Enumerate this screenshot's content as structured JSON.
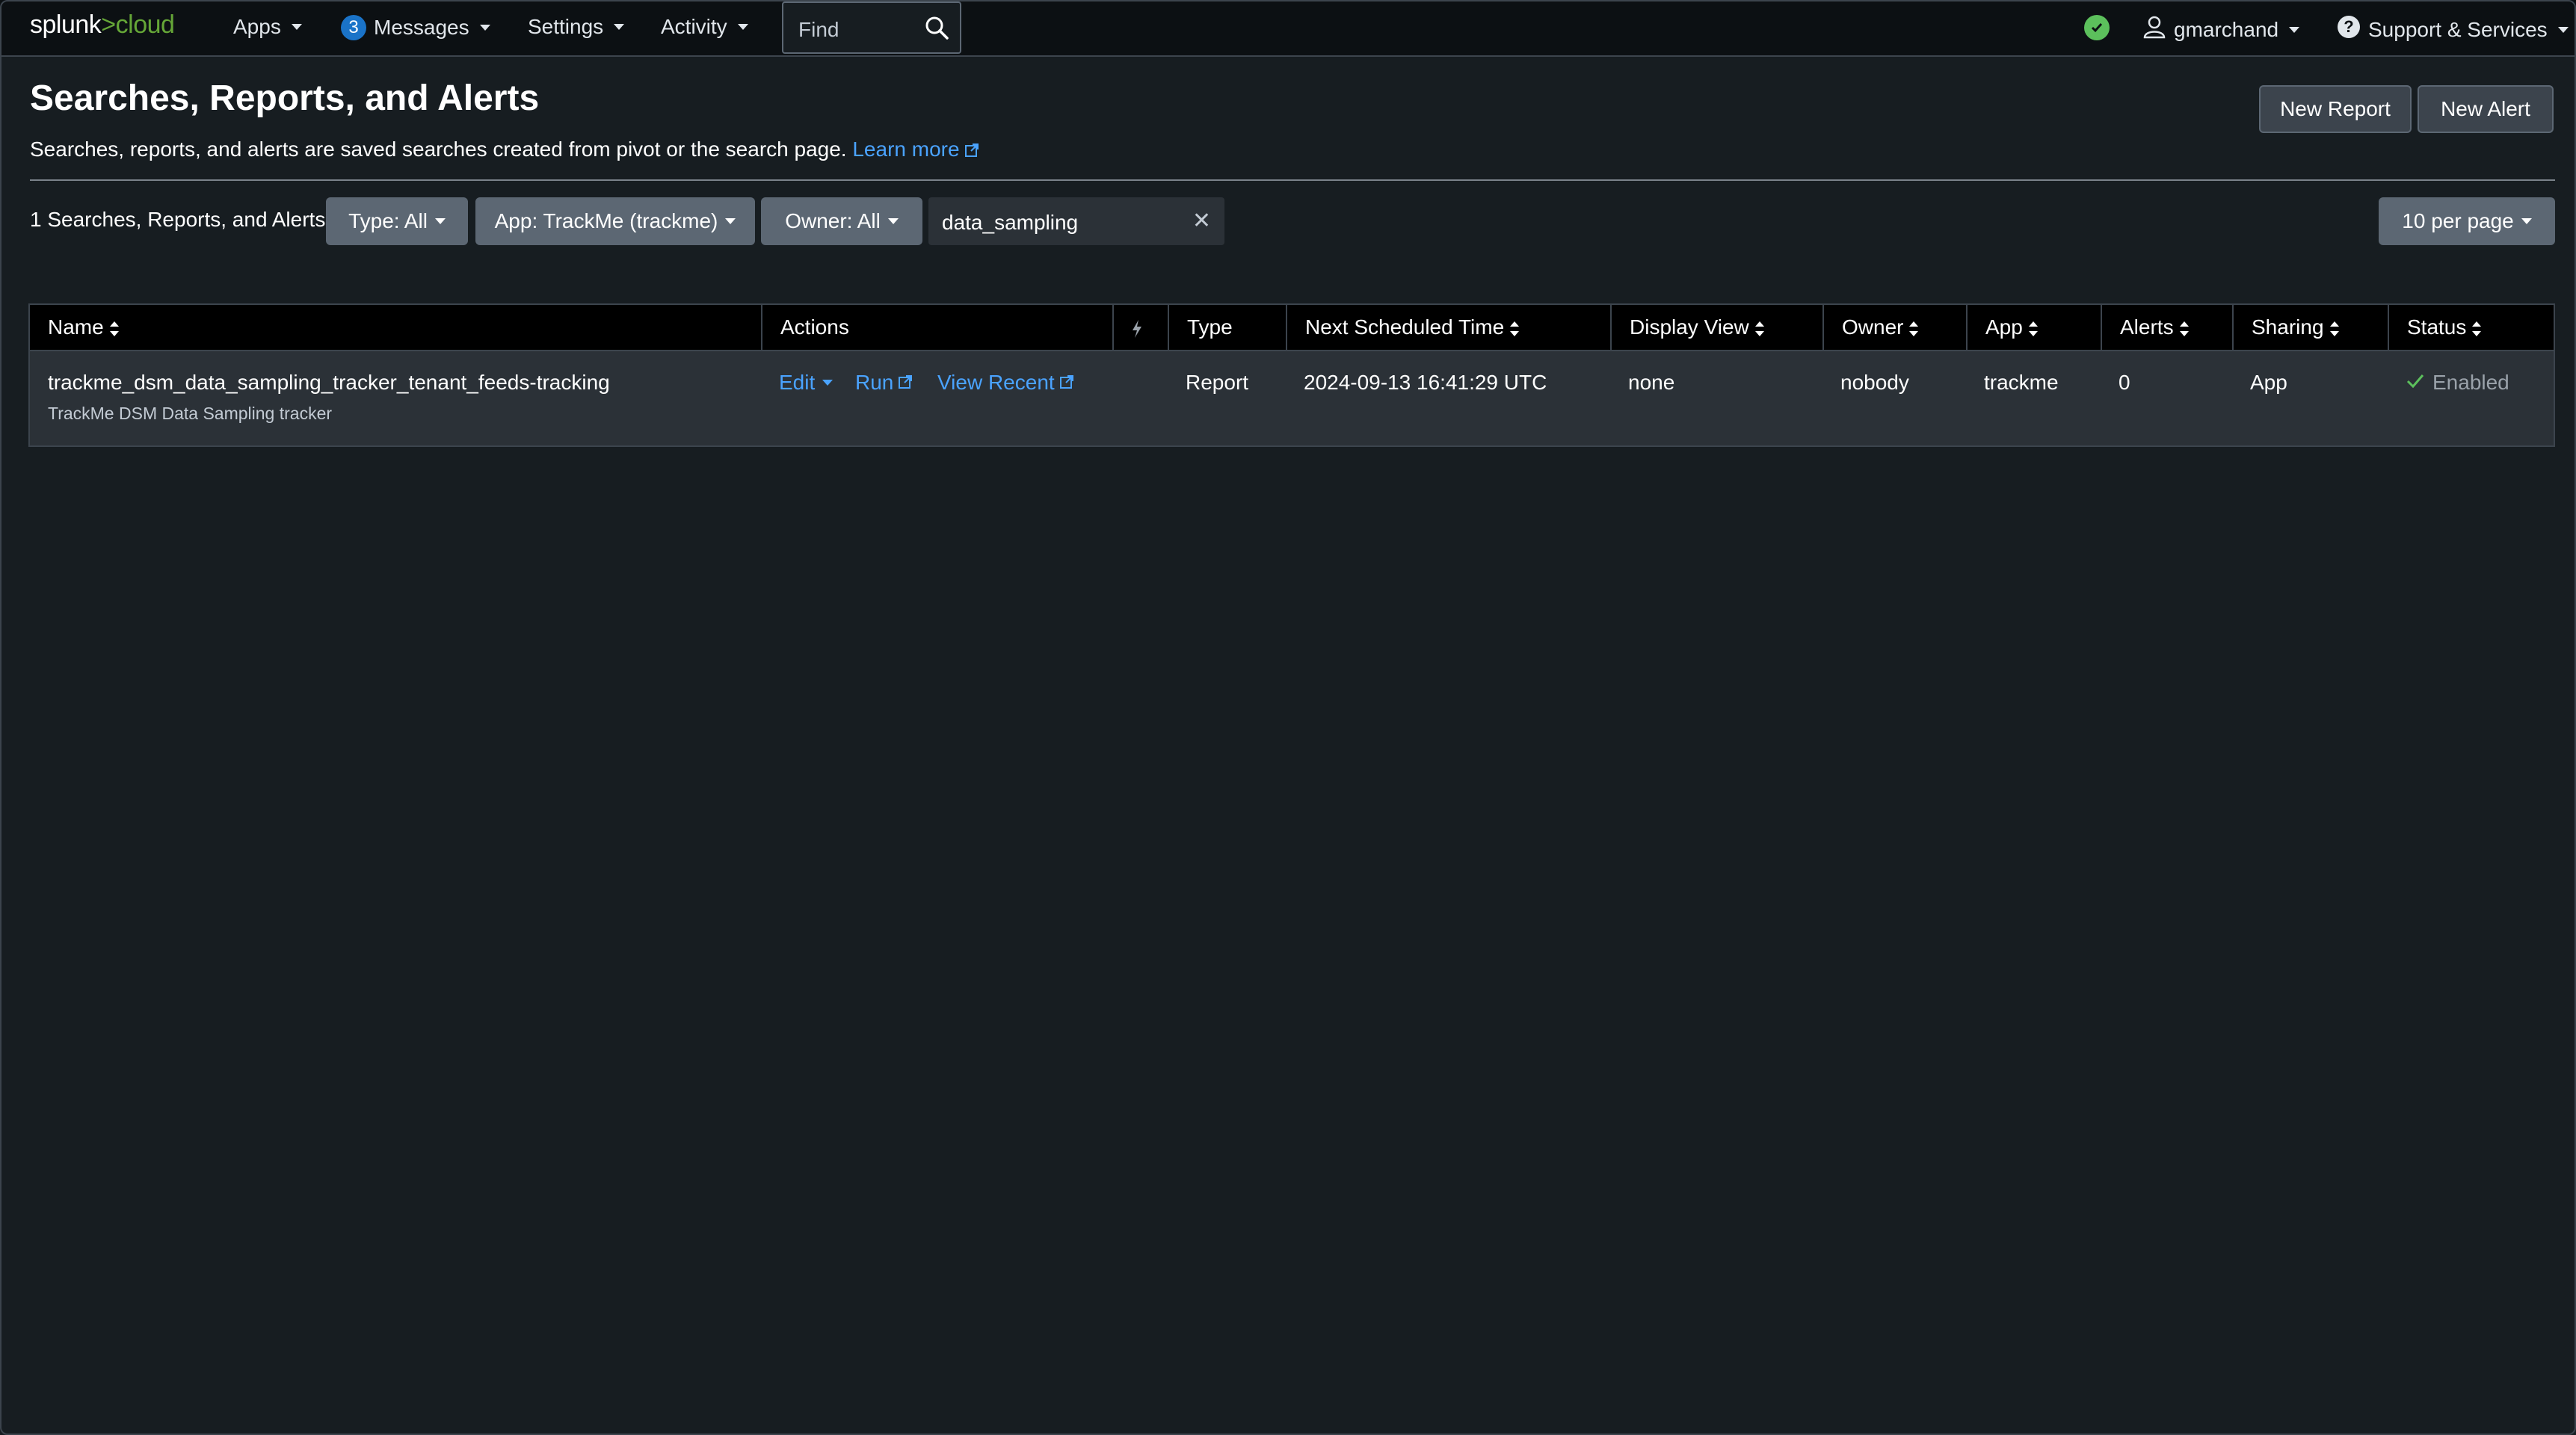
{
  "topbar": {
    "logo_main": "splunk",
    "logo_gt": ">",
    "logo_product": "cloud",
    "nav": {
      "apps": "Apps",
      "messages_count": "3",
      "messages": "Messages",
      "settings": "Settings",
      "activity": "Activity"
    },
    "find_placeholder": "Find",
    "user": "gmarchand",
    "support": "Support & Services",
    "health_status_color": "#5cc05c"
  },
  "page": {
    "title": "Searches, Reports, and Alerts",
    "subtitle": "Searches, reports, and alerts are saved searches created from pivot or the search page.",
    "learn_more": "Learn more",
    "new_report": "New Report",
    "new_alert": "New Alert"
  },
  "filters": {
    "count_label": "1 Searches, Reports, and Alerts",
    "type": "Type: All",
    "app": "App: TrackMe (trackme)",
    "owner": "Owner: All",
    "search_value": "data_sampling",
    "per_page": "10 per page"
  },
  "table": {
    "headers": {
      "name": "Name",
      "actions": "Actions",
      "type": "Type",
      "next_scheduled": "Next Scheduled Time",
      "display_view": "Display View",
      "owner": "Owner",
      "app": "App",
      "alerts": "Alerts",
      "sharing": "Sharing",
      "status": "Status"
    },
    "rows": [
      {
        "name": "trackme_dsm_data_sampling_tracker_tenant_feeds-tracking",
        "description": "TrackMe DSM Data Sampling tracker",
        "edit": "Edit",
        "run": "Run",
        "view_recent": "View Recent",
        "type": "Report",
        "next_scheduled": "2024-09-13 16:41:29 UTC",
        "display_view": "none",
        "owner": "nobody",
        "app": "trackme",
        "alerts": "0",
        "sharing": "App",
        "status": "Enabled"
      }
    ]
  },
  "colors": {
    "background": "#171d21",
    "topbar": "#0c1013",
    "link": "#4aa3ff",
    "brand_green": "#65a637",
    "button": "#5c6773"
  }
}
